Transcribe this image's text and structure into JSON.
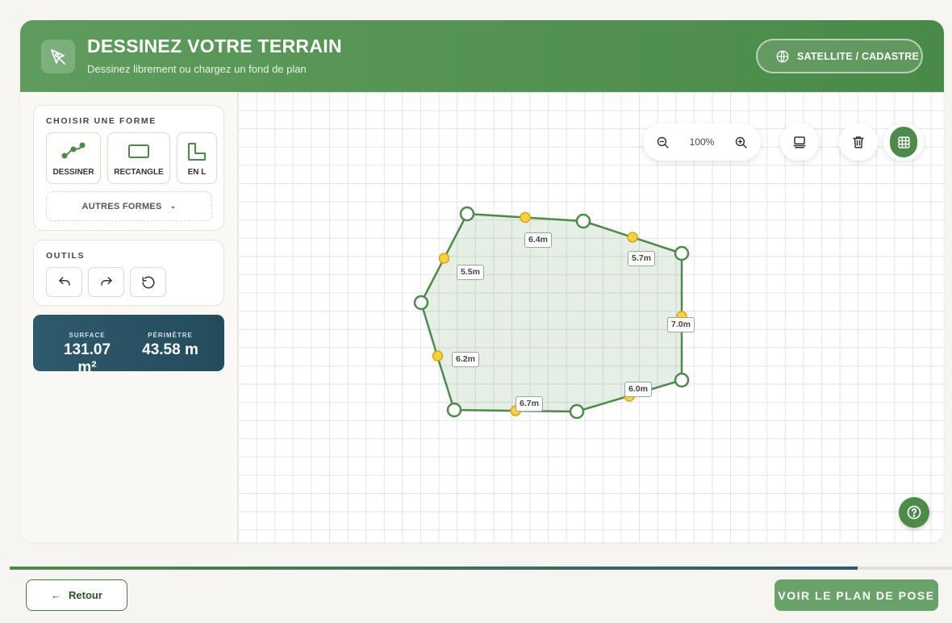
{
  "header": {
    "title": "DESSINEZ VOTRE TERRAIN",
    "subtitle": "Dessinez librement ou chargez un fond de plan",
    "satellite_label": "SATELLITE / CADASTRE",
    "icon": "pen-tool-icon"
  },
  "sidebar": {
    "shapes_title": "CHOISIR UNE FORME",
    "shapes": [
      {
        "label": "DESSINER",
        "icon": "draw-path-icon",
        "selected": true
      },
      {
        "label": "RECTANGLE",
        "icon": "rectangle-icon"
      },
      {
        "label": "EN L",
        "icon": "l-shape-icon"
      }
    ],
    "more_shapes_label": "AUTRES FORMES",
    "tools_title": "OUTILS",
    "tools": [
      "undo-icon",
      "redo-icon",
      "reset-icon"
    ]
  },
  "stats": {
    "surface_label": "SURFACE",
    "surface_value": "131.07 m²",
    "perimeter_label": "PÉRIMÈTRE",
    "perimeter_value": "43.58 m"
  },
  "canvas": {
    "zoom_level": "100%",
    "measurements": [
      "6.4m",
      "5.7m",
      "5.5m",
      "7.0m",
      "6.2m",
      "6.0m",
      "6.7m"
    ]
  },
  "footer": {
    "back_label": "Retour",
    "next_label": "VOIR LE PLAN DE POSE",
    "progress": 0.9
  },
  "colors": {
    "primary": "#4e8b4b",
    "stats_bg": "#2d5a6c",
    "vertex_mid": "#f5d33a"
  }
}
